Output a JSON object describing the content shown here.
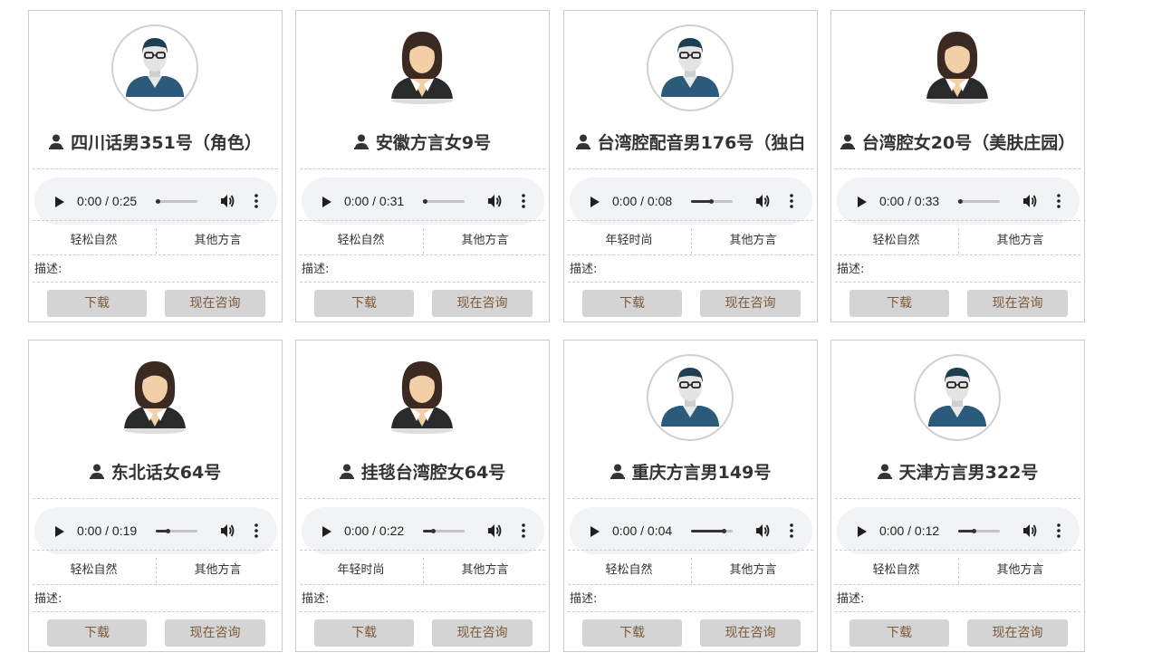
{
  "labels": {
    "download": "下载",
    "consult": "现在咨询",
    "description": "描述:"
  },
  "colors": {
    "male_shirt": "#2c5a7a",
    "female_hair": "#3a2a22",
    "skin": "#f3cfa8",
    "button_bg": "#d4d4d4",
    "button_text": "#7a5a3a"
  },
  "icons": {
    "play": "play-icon",
    "volume": "volume-icon",
    "more": "more-options-icon",
    "person": "person-icon"
  },
  "voices": [
    {
      "name": "四川话男351号（角色）",
      "gender": "male",
      "time": "0:00 / 0:25",
      "progress": 0.03,
      "tags": [
        "轻松自然",
        "其他方言"
      ]
    },
    {
      "name": "安徽方言女9号",
      "gender": "female",
      "time": "0:00 / 0:31",
      "progress": 0.03,
      "tags": [
        "轻松自然",
        "其他方言"
      ]
    },
    {
      "name": "台湾腔配音男176号（独白",
      "gender": "male",
      "time": "0:00 / 0:08",
      "progress": 0.5,
      "tags": [
        "年轻时尚",
        "其他方言"
      ]
    },
    {
      "name": "台湾腔女20号（美肤庄园）",
      "gender": "female",
      "time": "0:00 / 0:33",
      "progress": 0.03,
      "tags": [
        "轻松自然",
        "其他方言"
      ]
    },
    {
      "name": "东北话女64号",
      "gender": "female",
      "time": "0:00 / 0:19",
      "progress": 0.3,
      "tags": [
        "轻松自然",
        "其他方言"
      ]
    },
    {
      "name": "挂毯台湾腔女64号",
      "gender": "female",
      "time": "0:00 / 0:22",
      "progress": 0.25,
      "tags": [
        "年轻时尚",
        "其他方言"
      ]
    },
    {
      "name": "重庆方言男149号",
      "gender": "male",
      "time": "0:00 / 0:04",
      "progress": 0.8,
      "tags": [
        "轻松自然",
        "其他方言"
      ]
    },
    {
      "name": "天津方言男322号",
      "gender": "male",
      "time": "0:00 / 0:12",
      "progress": 0.4,
      "tags": [
        "轻松自然",
        "其他方言"
      ]
    }
  ]
}
